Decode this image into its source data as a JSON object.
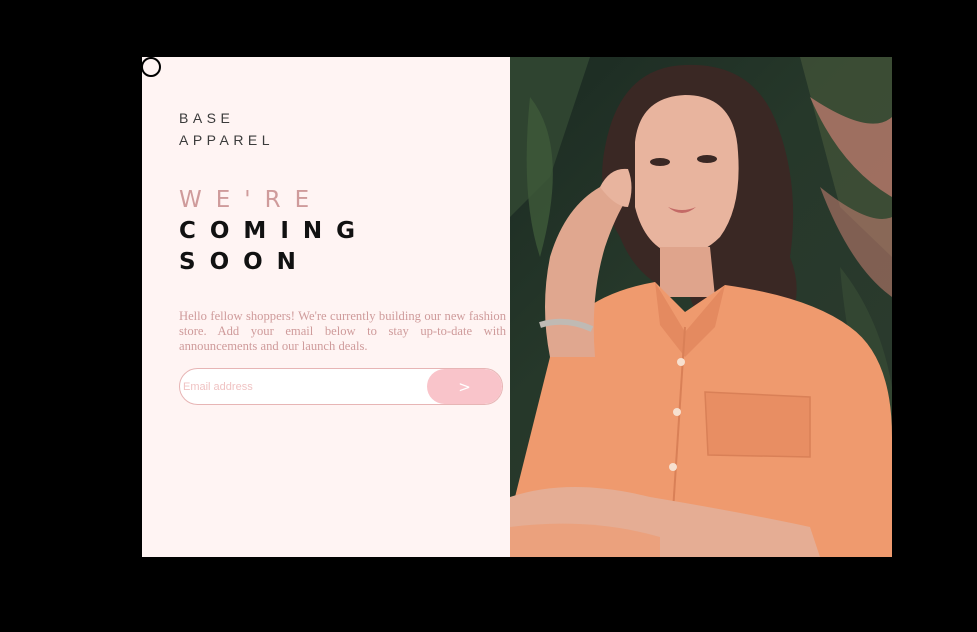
{
  "brand": {
    "line1": "BASE",
    "line2": "APPAREL"
  },
  "headline": {
    "line1": "WE'RE",
    "line2": "COMING",
    "line3": "SOON"
  },
  "description": "Hello fellow shoppers! We're currently building our new fashion store. Add your email below to stay up-to-date with announcements and our launch deals.",
  "form": {
    "placeholder": "Email address",
    "submit_label": ">"
  },
  "colors": {
    "accent": "#cf9b9b",
    "panel_bg": "#fff4f3",
    "button_bg": "#f9c4ca",
    "input_border": "#e7b5b5"
  },
  "hero_image": {
    "description_icon": "woman-portrait-photo"
  }
}
